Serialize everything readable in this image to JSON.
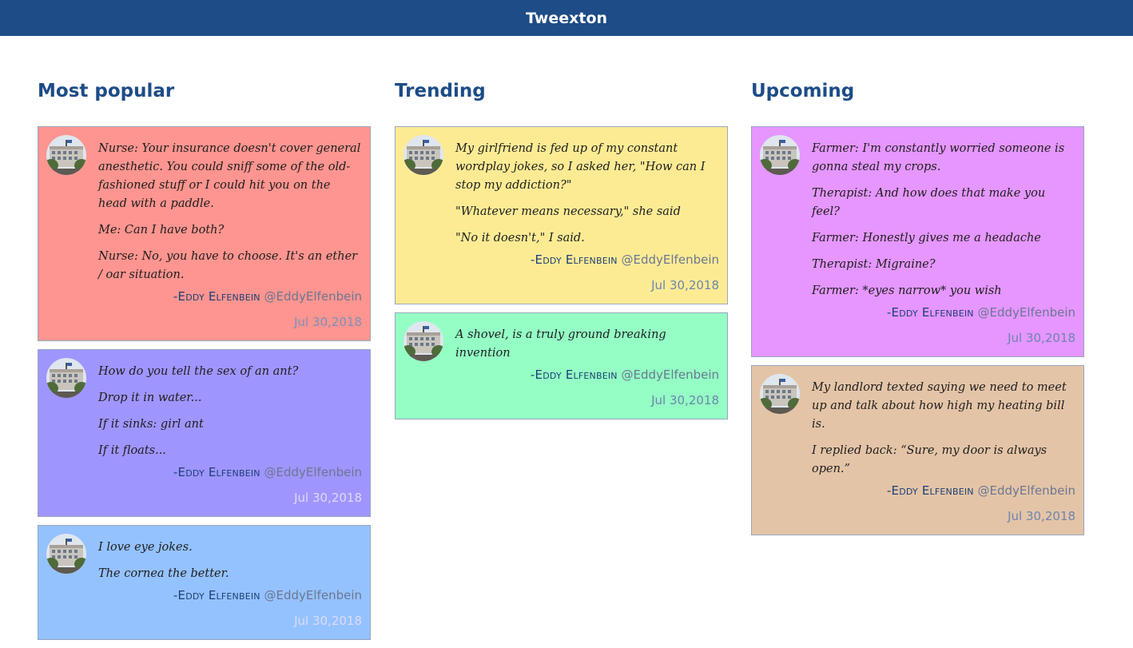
{
  "app": {
    "title": "Tweexton"
  },
  "author": {
    "name": "-Eddy Elfenbein",
    "handle": "@EddyElfenbein"
  },
  "columns": [
    {
      "title": "Most popular",
      "cards": [
        {
          "lines": [
            "Nurse: Your insurance doesn't cover general anesthetic. You could sniff some of the old-fashioned stuff or I could hit you on the head with a paddle.",
            "Me: Can I have both?",
            "Nurse: No, you have to choose. It's an ether / oar situation."
          ],
          "date": "Jul 30,2018"
        },
        {
          "lines": [
            "How do you tell the sex of an ant?",
            "Drop it in water...",
            "If it sinks: girl ant",
            "If it floats..."
          ],
          "date": "Jul 30,2018"
        },
        {
          "lines": [
            "I love eye jokes.",
            "The cornea the better."
          ],
          "date": "Jul 30,2018"
        }
      ]
    },
    {
      "title": "Trending",
      "cards": [
        {
          "lines": [
            "My girlfriend is fed up of my constant wordplay jokes, so I asked her, \"How can I stop my addiction?\"",
            "\"Whatever means necessary,\" she said",
            "\"No it doesn't,\" I said."
          ],
          "date": "Jul 30,2018"
        },
        {
          "lines": [
            "A shovel, is a truly ground breaking invention"
          ],
          "date": "Jul 30,2018"
        }
      ]
    },
    {
      "title": "Upcoming",
      "cards": [
        {
          "lines": [
            "Farmer: I'm constantly worried someone is gonna steal my crops.",
            "Therapist: And how does that make you feel?",
            "Farmer: Honestly gives me a headache",
            "Therapist: Migraine?",
            "Farmer: *eyes narrow* you wish"
          ],
          "date": "Jul 30,2018"
        },
        {
          "lines": [
            "My landlord texted saying we need to meet up and talk about how high my heating bill is.",
            "I replied back: “Sure, my door is always open.”"
          ],
          "date": "Jul 30,2018"
        }
      ]
    }
  ],
  "colors": {
    "header": "#1d4c87",
    "cards": [
      "#ff9590",
      "#9f95ff",
      "#94c2ff",
      "#fdeb94",
      "#94fec5",
      "#e596ff",
      "#e4c4a7"
    ]
  }
}
